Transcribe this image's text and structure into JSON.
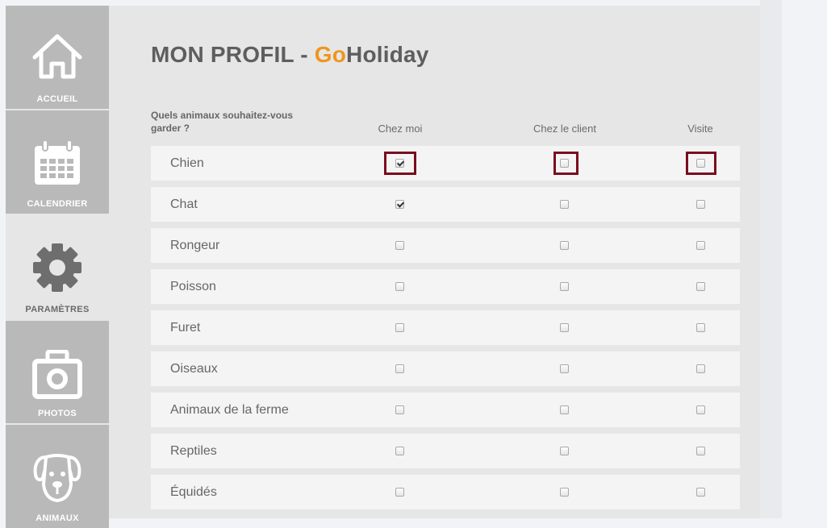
{
  "sidebar": {
    "items": [
      {
        "label": "ACCUEIL",
        "icon": "home-icon",
        "active": false
      },
      {
        "label": "CALENDRIER",
        "icon": "calendar-icon",
        "active": false
      },
      {
        "label": "PARAMÈTRES",
        "icon": "gear-icon",
        "active": true
      },
      {
        "label": "PHOTOS",
        "icon": "camera-icon",
        "active": false
      },
      {
        "label": "ANIMAUX",
        "icon": "dog-icon",
        "active": false
      }
    ]
  },
  "header": {
    "title_prefix": "MON PROFIL - ",
    "title_go": "Go",
    "title_suffix": "Holiday",
    "brand_color": "#f0951f"
  },
  "form": {
    "question": "Quels animaux souhaitez-vous garder ?",
    "columns": [
      "Chez moi",
      "Chez le client",
      "Visite"
    ],
    "rows": [
      {
        "label": "Chien",
        "checked": [
          true,
          false,
          false
        ],
        "highlighted": true
      },
      {
        "label": "Chat",
        "checked": [
          true,
          false,
          false
        ]
      },
      {
        "label": "Rongeur",
        "checked": [
          false,
          false,
          false
        ]
      },
      {
        "label": "Poisson",
        "checked": [
          false,
          false,
          false
        ]
      },
      {
        "label": "Furet",
        "checked": [
          false,
          false,
          false
        ]
      },
      {
        "label": "Oiseaux",
        "checked": [
          false,
          false,
          false
        ]
      },
      {
        "label": "Animaux de la ferme",
        "checked": [
          false,
          false,
          false
        ]
      },
      {
        "label": "Reptiles",
        "checked": [
          false,
          false,
          false
        ]
      },
      {
        "label": "Équidés",
        "checked": [
          false,
          false,
          false
        ]
      }
    ],
    "highlight_color": "#7a0c1e"
  }
}
